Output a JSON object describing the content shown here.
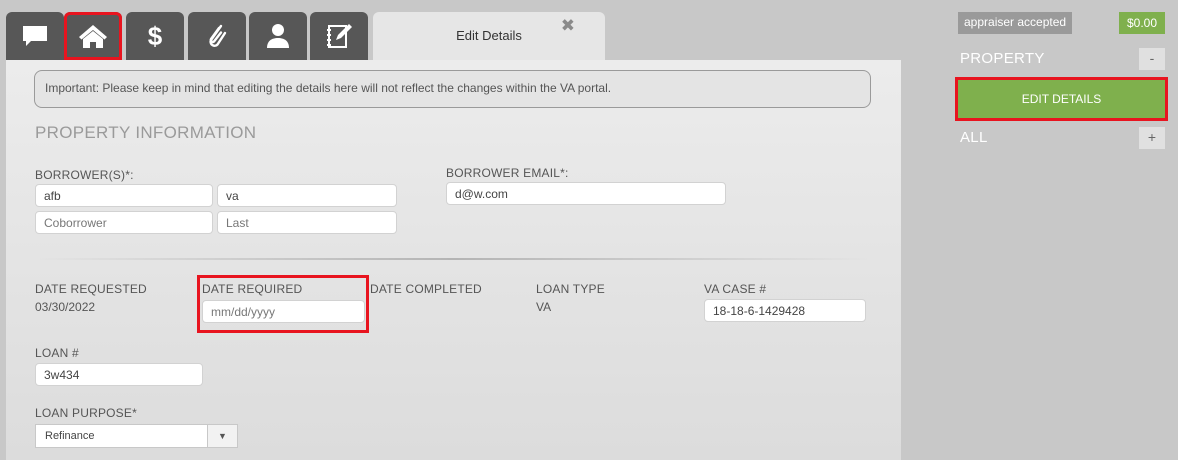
{
  "tabs": {
    "items": [
      {
        "icon": "chat-bubble-icon"
      },
      {
        "icon": "home-icon"
      },
      {
        "icon": "dollar-icon"
      },
      {
        "icon": "paperclip-icon"
      },
      {
        "icon": "user-icon"
      },
      {
        "icon": "edit-note-icon"
      }
    ],
    "active_label": "Edit Details",
    "close_symbol": "✖"
  },
  "notice": "Important: Please keep in mind that editing the details here will not reflect the changes within the VA portal.",
  "section_title": "PROPERTY INFORMATION",
  "borrowers": {
    "label": "BORROWER(S)*:",
    "first_name": "afb",
    "last_name": "va",
    "coborrower_placeholder": "Coborrower",
    "last_placeholder": "Last"
  },
  "borrower_email": {
    "label": "BORROWER EMAIL*:",
    "value": "d@w.com"
  },
  "date_requested": {
    "label": "DATE REQUESTED",
    "value": "03/30/2022"
  },
  "date_required": {
    "label": "DATE REQUIRED",
    "placeholder": "mm/dd/yyyy"
  },
  "date_completed": {
    "label": "DATE COMPLETED"
  },
  "loan_type": {
    "label": "LOAN TYPE",
    "value": "VA"
  },
  "va_case": {
    "label": "VA CASE #",
    "value": "18-18-6-1429428"
  },
  "loan_number": {
    "label": "LOAN #",
    "value": "3w434"
  },
  "loan_purpose": {
    "label": "LOAN PURPOSE*",
    "selected": "Refinance",
    "arrow": "▼"
  },
  "sidebar": {
    "status": "appraiser accepted",
    "price": "$0.00",
    "property_label": "PROPERTY",
    "property_toggle": "-",
    "edit_details": "EDIT DETAILS",
    "all_label": "ALL",
    "all_toggle": "+"
  },
  "colors": {
    "accent_green": "#7fb04d",
    "highlight_red": "#e8141f",
    "tab_dark": "#575757"
  }
}
